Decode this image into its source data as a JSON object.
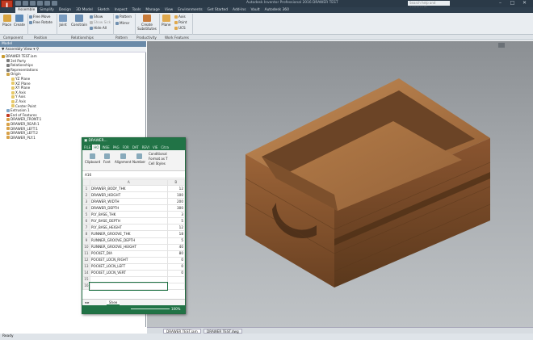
{
  "app": {
    "app_button_letter": "I",
    "window_title": "Autodesk Inventor Professional 2016   DRAWER TEST",
    "search_placeholder": "Search help and commands..."
  },
  "ribbon_tabs": [
    "Assemble",
    "Simplify",
    "Design",
    "3D Model",
    "Sketch",
    "Inspect",
    "Tools",
    "Manage",
    "View",
    "Environments",
    "Get Started",
    "Add-Ins",
    "Vault",
    "Autodesk 360"
  ],
  "active_tab": "Assemble",
  "ribbon": {
    "place": "Place",
    "create": "Create",
    "free_move": "Free Move",
    "free_rotate": "Free Rotate",
    "joint": "Joint",
    "constrain": "Constrain",
    "show": "Show",
    "show_sick": "Show Sick",
    "hide_all": "Hide All",
    "pattern": "Pattern",
    "mirror": "Mirror",
    "create_substitutes": "Create Substitutes",
    "plane": "Plane",
    "axis": "Axis",
    "point": "Point",
    "ucs": "UCS",
    "groups": {
      "component": "Component",
      "position": "Position",
      "relationships": "Relationships",
      "pattern": "Pattern",
      "productivity": "Productivity",
      "work_features": "Work Features"
    }
  },
  "browser": {
    "title": "Model",
    "view_selector": "Assembly View",
    "tree": [
      {
        "label": "DRAWER TEST.iam",
        "indent": 0,
        "color": "#c99a2e"
      },
      {
        "label": "3rd Party",
        "indent": 1,
        "color": "#7c7c7c"
      },
      {
        "label": "Relationships",
        "indent": 1,
        "color": "#7c7c7c"
      },
      {
        "label": "Representations",
        "indent": 1,
        "color": "#7c7c7c"
      },
      {
        "label": "Origin",
        "indent": 1,
        "color": "#d0a64a"
      },
      {
        "label": "YZ Plane",
        "indent": 2,
        "color": "#e7c96a"
      },
      {
        "label": "XZ Plane",
        "indent": 2,
        "color": "#e7c96a"
      },
      {
        "label": "XY Plane",
        "indent": 2,
        "color": "#e7c96a"
      },
      {
        "label": "X Axis",
        "indent": 2,
        "color": "#e7c96a"
      },
      {
        "label": "Y Axis",
        "indent": 2,
        "color": "#e7c96a"
      },
      {
        "label": "Z Axis",
        "indent": 2,
        "color": "#e7c96a"
      },
      {
        "label": "Center Point",
        "indent": 2,
        "color": "#e7c96a"
      },
      {
        "label": "Extrusion 1",
        "indent": 1,
        "color": "#7fa6c9"
      },
      {
        "label": "End of Features",
        "indent": 1,
        "color": "#c23a22"
      },
      {
        "label": "DRAWER_FRONT:1",
        "indent": 1,
        "color": "#d8a24a"
      },
      {
        "label": "DRAWER_REAR:1",
        "indent": 1,
        "color": "#d8a24a"
      },
      {
        "label": "DRAWER_LEFT:1",
        "indent": 1,
        "color": "#d8a24a"
      },
      {
        "label": "DRAWER_LEFT:2",
        "indent": 1,
        "color": "#d8a24a"
      },
      {
        "label": "DRAWER_PLY:1",
        "indent": 1,
        "color": "#d8a24a"
      }
    ]
  },
  "document_tabs": [
    "DRAWER TEST.iam",
    "DRAWER TEST.dwg"
  ],
  "status": "Ready",
  "excel": {
    "title": "DRAWER...",
    "tabs": [
      "FILE",
      "HO",
      "INSE",
      "PAG",
      "FOR",
      "DAT",
      "REVI",
      "VIE",
      "Citra"
    ],
    "active_tab": "HO",
    "groups": [
      "Clipboard",
      "Font",
      "Alignment",
      "Number"
    ],
    "styles": [
      "Conditional",
      "Format as T",
      "Cell Styles"
    ],
    "cell_ref": "A16",
    "col_a": "A",
    "col_b": "B",
    "rows": [
      {
        "n": "1",
        "a": "DRAWER_BODY_THK",
        "b": "12"
      },
      {
        "n": "2",
        "a": "DRAWER_HEIGHT",
        "b": "100"
      },
      {
        "n": "3",
        "a": "DRAWER_WIDTH",
        "b": "200"
      },
      {
        "n": "4",
        "a": "DRAWER_DEPTH",
        "b": "300"
      },
      {
        "n": "5",
        "a": "PLY_BASE_THK",
        "b": "3"
      },
      {
        "n": "6",
        "a": "PLY_BASE_DEPTH",
        "b": "5"
      },
      {
        "n": "7",
        "a": "PLY_BASE_HEIGHT",
        "b": "12"
      },
      {
        "n": "8",
        "a": "RUNNER_GROOVE_THK",
        "b": "18"
      },
      {
        "n": "9",
        "a": "RUNNER_GROOVE_DEPTH",
        "b": "5"
      },
      {
        "n": "10",
        "a": "RUNNER_GROOVE_HEIGHT",
        "b": "40"
      },
      {
        "n": "11",
        "a": "POCKET_DIA",
        "b": "80"
      },
      {
        "n": "12",
        "a": "POCKET_LOCN_RIGHT",
        "b": "0"
      },
      {
        "n": "13",
        "a": "POCKET_LOCN_LEFT",
        "b": "0"
      },
      {
        "n": "14",
        "a": "POCKET_LOCN_VERT",
        "b": "0"
      },
      {
        "n": "15",
        "a": "",
        "b": ""
      },
      {
        "n": "16",
        "a": "",
        "b": ""
      }
    ],
    "sheet_tab": "Shee",
    "zoom": "100%"
  },
  "colors": {
    "wood_light": "#b27a47",
    "wood_mid": "#8e5a31",
    "wood_dark": "#5e3a1e",
    "excel_green": "#217346",
    "inventor_red": "#c23a22"
  }
}
